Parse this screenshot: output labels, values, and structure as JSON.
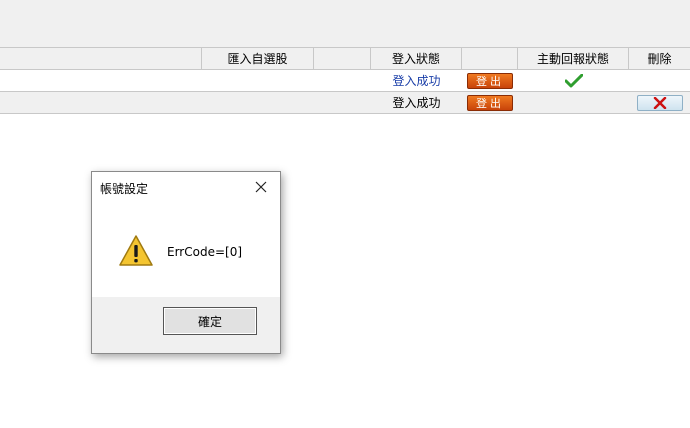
{
  "table": {
    "headers": [
      "",
      "匯入自選股",
      "",
      "登入狀態",
      "",
      "主動回報狀態",
      "刪除"
    ],
    "rows": [
      {
        "status": "登入成功",
        "logout_label": "登出",
        "report_checked": true,
        "has_delete": false
      },
      {
        "status": "登入成功",
        "logout_label": "登出",
        "report_checked": false,
        "has_delete": true
      }
    ]
  },
  "dialog": {
    "title": "帳號設定",
    "message": "ErrCode=[0]",
    "ok_label": "確定",
    "icon": "warning-icon"
  },
  "colors": {
    "status_blue": "#1a3ea8",
    "logout_orange": "#e0601a",
    "check_green": "#2f9e2f",
    "delete_red": "#cc1111"
  }
}
